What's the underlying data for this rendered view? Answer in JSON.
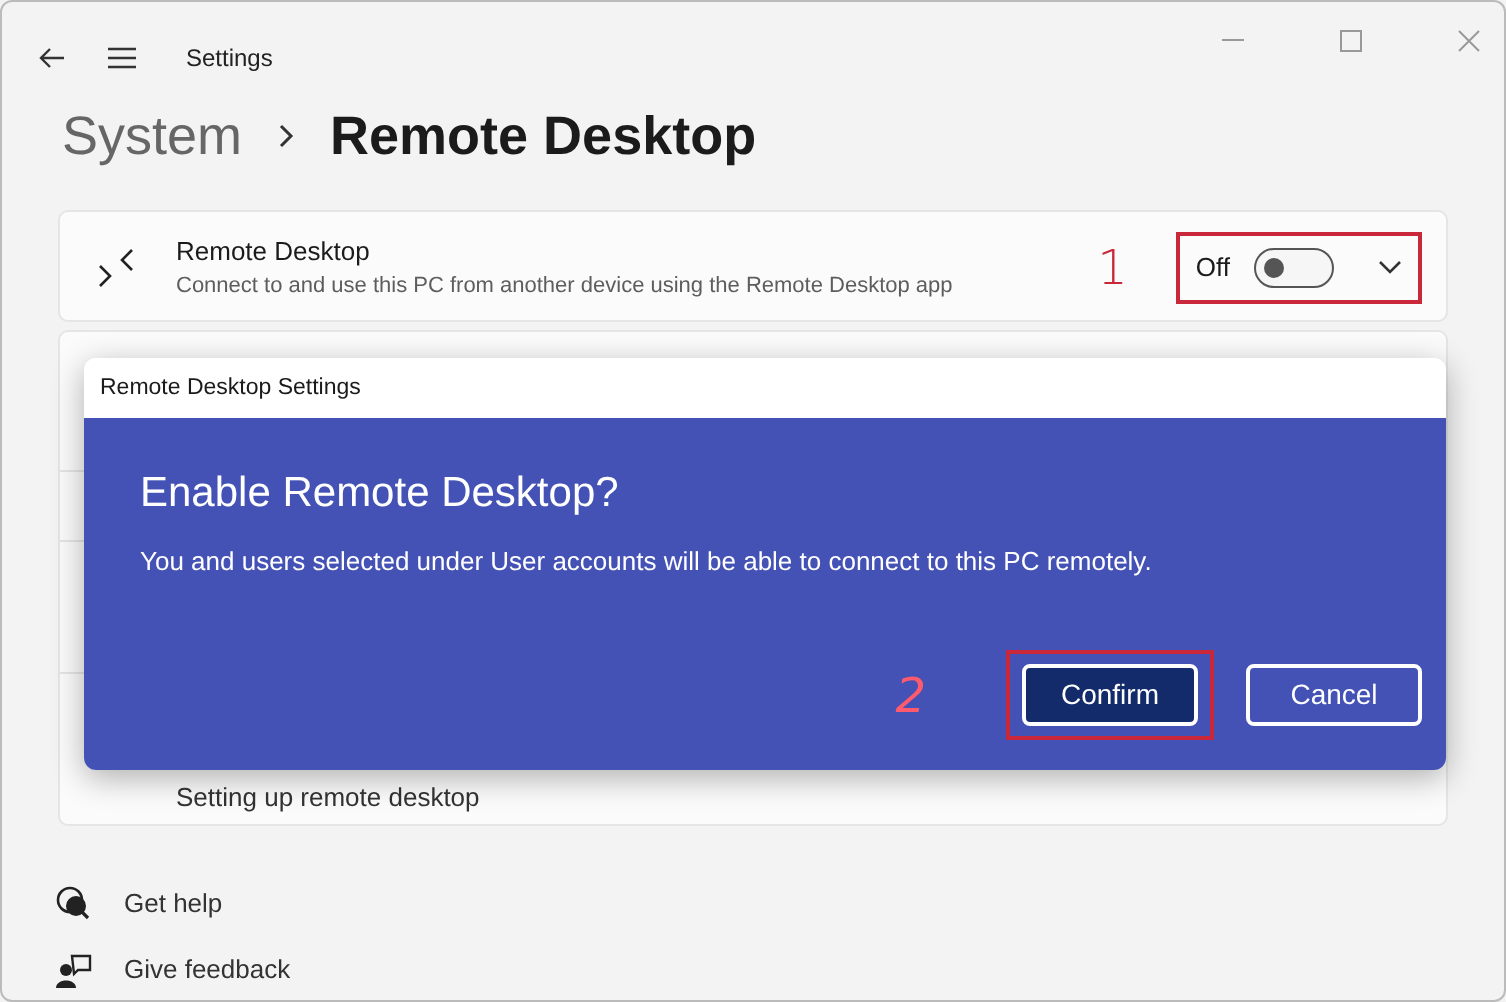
{
  "window": {
    "title": "Settings"
  },
  "breadcrumb": [
    {
      "label": "System",
      "selected": false
    },
    {
      "label": "Remote Desktop",
      "selected": true
    }
  ],
  "setting": {
    "title": "Remote Desktop",
    "description": "Connect to and use this PC from another device using the Remote Desktop app",
    "state_label": "Off",
    "on": false,
    "expanded": false,
    "annotation": "1"
  },
  "background_link": "Setting up remote desktop",
  "dialog": {
    "title": "Remote Desktop Settings",
    "heading": "Enable Remote Desktop?",
    "message": "You and users selected under User accounts will be able to connect to this PC remotely.",
    "buttons": [
      {
        "label": "Confirm",
        "kind": "primary",
        "annotation": "2"
      },
      {
        "label": "Cancel",
        "kind": "secondary"
      }
    ]
  },
  "footer_links": [
    {
      "label": "Get help",
      "kind": "help"
    },
    {
      "label": "Give feedback",
      "kind": "feedback"
    }
  ]
}
